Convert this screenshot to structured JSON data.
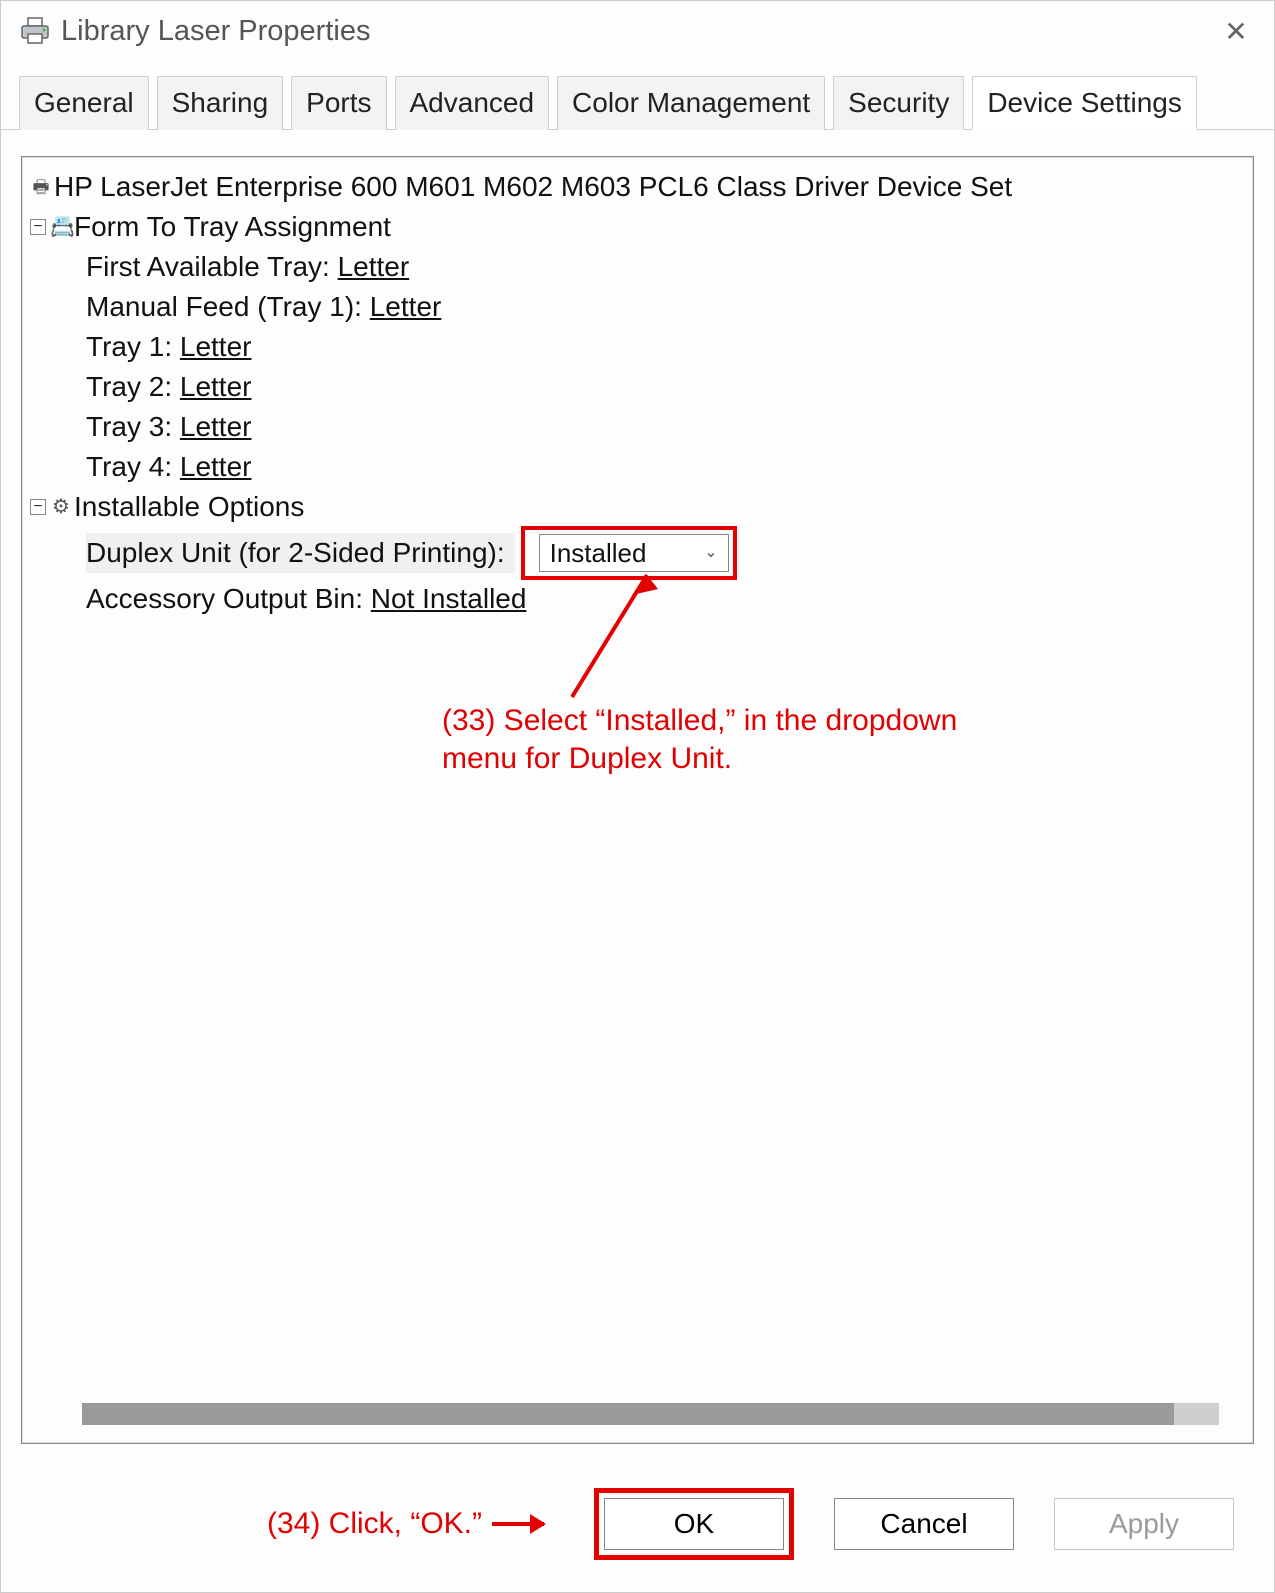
{
  "window": {
    "title": "Library Laser Properties"
  },
  "tabs": {
    "items": [
      "General",
      "Sharing",
      "Ports",
      "Advanced",
      "Color Management",
      "Security",
      "Device Settings"
    ],
    "active_index": 6
  },
  "tree": {
    "root_label": "HP LaserJet Enterprise 600 M601 M602 M603 PCL6 Class Driver Device Set",
    "groups": [
      {
        "label": "Form To Tray Assignment",
        "children": [
          {
            "label": "First Available Tray:",
            "value": "Letter"
          },
          {
            "label": "Manual Feed (Tray 1):",
            "value": "Letter"
          },
          {
            "label": "Tray 1:",
            "value": "Letter"
          },
          {
            "label": "Tray 2:",
            "value": "Letter"
          },
          {
            "label": "Tray 3:",
            "value": "Letter"
          },
          {
            "label": "Tray 4:",
            "value": "Letter"
          }
        ]
      },
      {
        "label": "Installable Options",
        "children": [
          {
            "label": "Duplex Unit (for 2-Sided Printing):",
            "selected": true,
            "dropdown_value": "Installed"
          },
          {
            "label": "Accessory Output Bin:",
            "value": "Not Installed"
          }
        ]
      }
    ]
  },
  "callouts": {
    "dropdown_text": "(33) Select “Installed,” in the dropdown menu for Duplex Unit.",
    "ok_text": "(34) Click, “OK.”"
  },
  "buttons": {
    "ok": "OK",
    "cancel": "Cancel",
    "apply": "Apply"
  }
}
